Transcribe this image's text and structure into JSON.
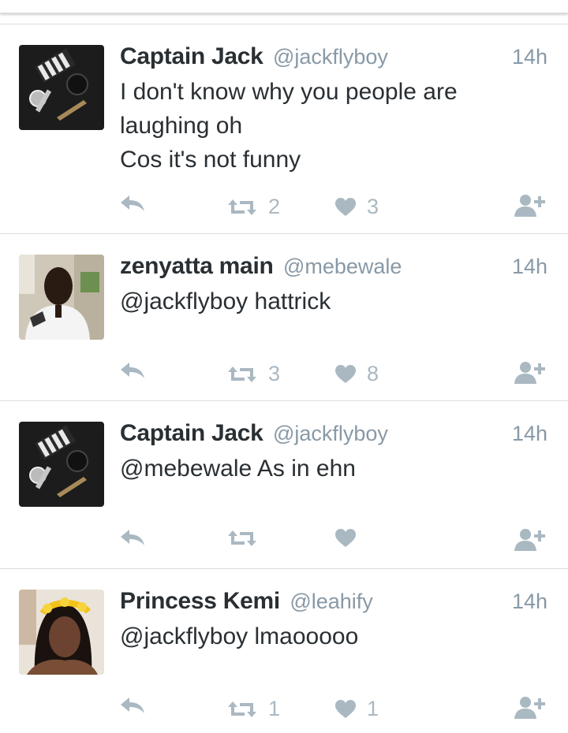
{
  "colors": {
    "name": "#292f33",
    "meta": "#8899a6",
    "icon": "#aab8c2",
    "divider": "#d9dee2"
  },
  "tweets": [
    {
      "name": "Captain Jack",
      "handle": "@jackflyboy",
      "time": "14h",
      "avatar": "pilot-epaulettes-watch",
      "lines": [
        "I don't know why you people are",
        "laughing oh",
        "Cos it's not funny"
      ],
      "retweets": "2",
      "likes": "3"
    },
    {
      "name": "zenyatta main",
      "handle": "@mebewale",
      "time": "14h",
      "avatar": "man-in-pilot-uniform",
      "lines": [
        "@jackflyboy hattrick"
      ],
      "retweets": "3",
      "likes": "8"
    },
    {
      "name": "Captain Jack",
      "handle": "@jackflyboy",
      "time": "14h",
      "avatar": "pilot-epaulettes-watch",
      "lines": [
        "@mebewale As in ehn"
      ],
      "retweets": "",
      "likes": ""
    },
    {
      "name": "Princess Kemi",
      "handle": "@leahify",
      "time": "14h",
      "avatar": "woman-flower-crown",
      "lines": [
        "@jackflyboy lmaooooo"
      ],
      "retweets": "1",
      "likes": "1"
    }
  ]
}
